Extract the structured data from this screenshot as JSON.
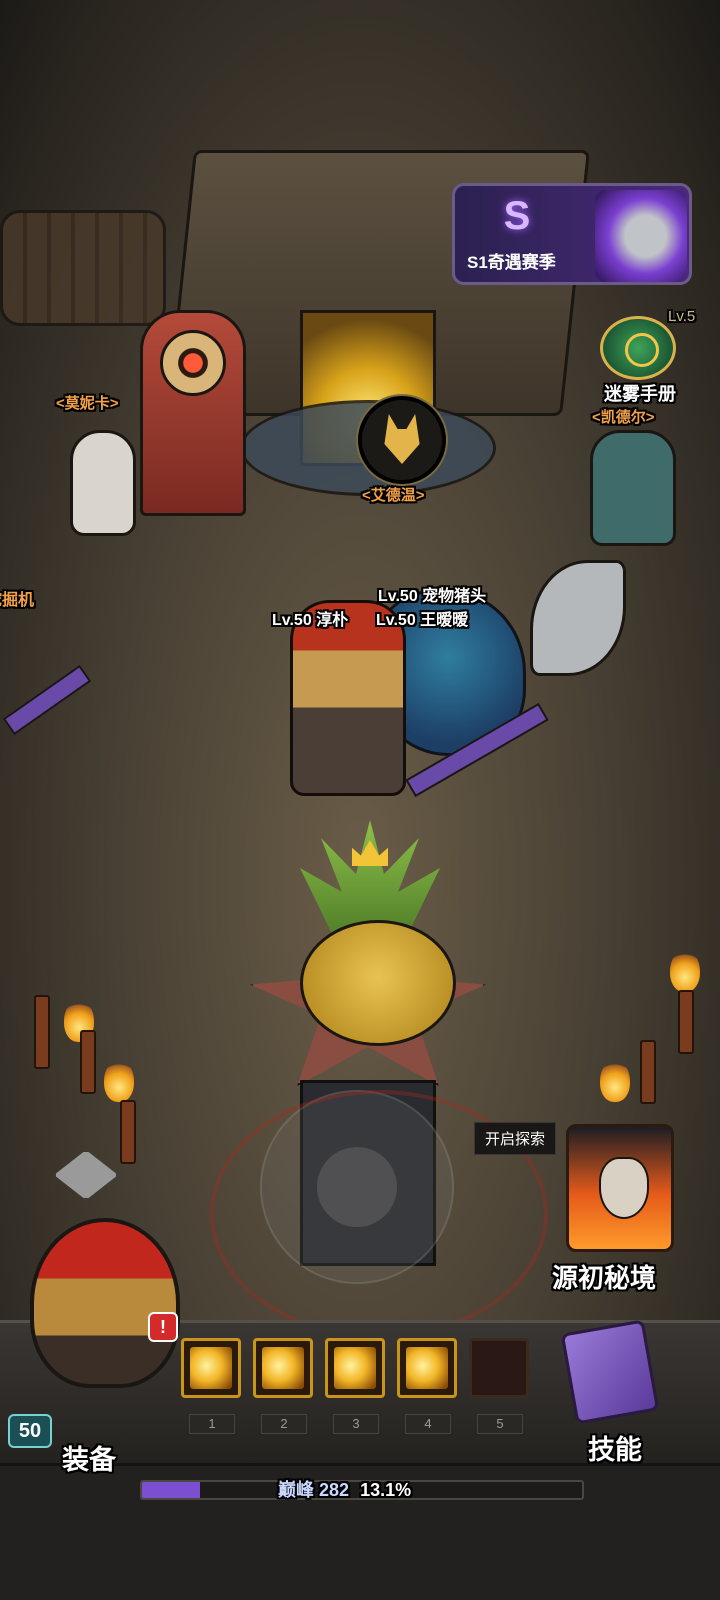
{
  "season": {
    "label": "S1奇遇赛季"
  },
  "npcs": {
    "monica": "<莫妮卡>",
    "edwin": "<艾德温>",
    "kaidel": "<凯德尔>",
    "digger": "挖掘机"
  },
  "fog_manual": {
    "label": "迷雾手册",
    "level_hint": "Lv.5"
  },
  "characters": {
    "pet_pig": "Lv.50 宠物猪头",
    "player1": "Lv.50 淳朴",
    "player2": "Lv.50 王暧暧"
  },
  "explore": {
    "tooltip": "开启探索",
    "label": "源初秘境"
  },
  "hud": {
    "equip_label": "装备",
    "skills_label": "技能",
    "player_level": "50",
    "notification": "!",
    "skill_slots": [
      "1",
      "2",
      "3",
      "4",
      "5"
    ],
    "progress": {
      "label": "巅峰",
      "value": "282",
      "percent": "13.1%",
      "fraction": 0.131
    }
  },
  "colors": {
    "npc_name": "#f3a24a",
    "progress_fill": "#7a4fd0",
    "gold": "#c8951a"
  },
  "icons": [
    "season-s-icon",
    "knight-helmet-icon",
    "fog-manual-icon",
    "wolf-portrait-icon",
    "demon-skull-gate-icon",
    "hero-portrait-icon",
    "skill-book-icon"
  ]
}
